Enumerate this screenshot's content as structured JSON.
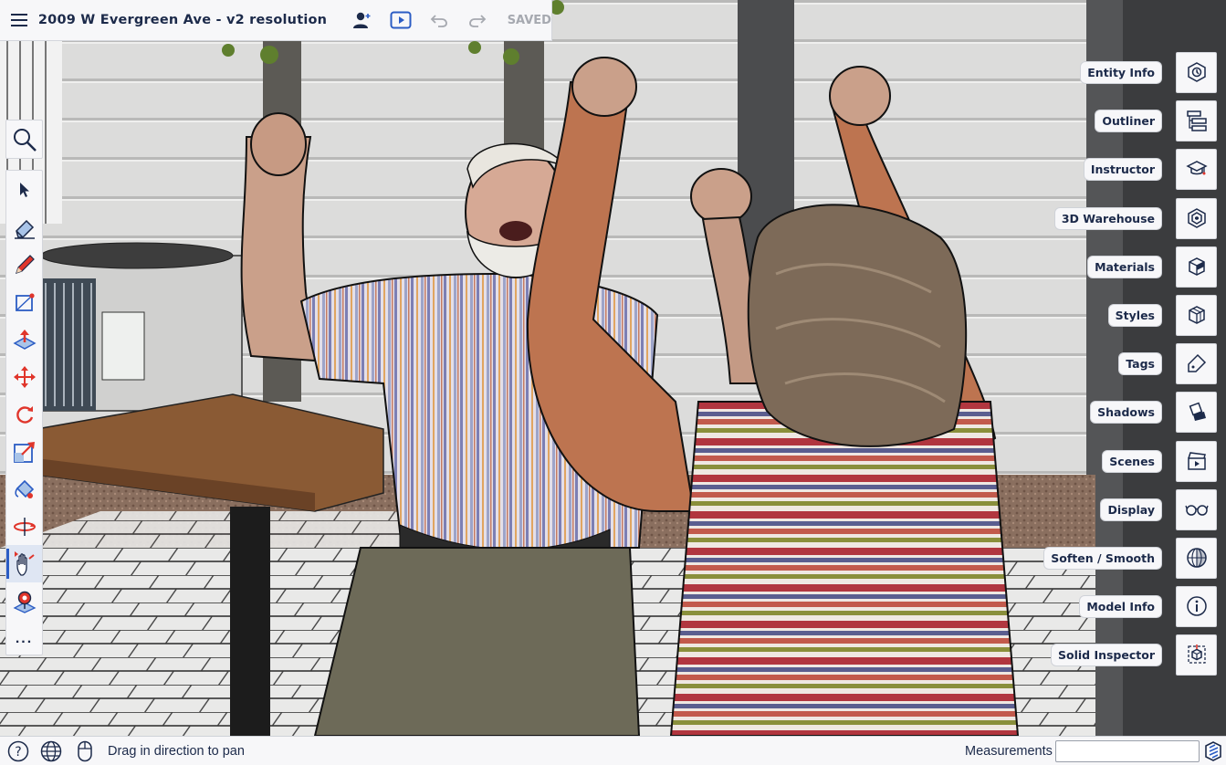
{
  "app": {
    "title": "2009 W Evergreen Ave - v2 resolution",
    "save_status": "SAVED",
    "accent": "#2b5cc4",
    "text_color": "#1c2a4a"
  },
  "topbar": {
    "icons": [
      "menu-icon",
      "collaborator-icon",
      "presentation-play-icon",
      "undo-icon",
      "redo-icon"
    ]
  },
  "left_toolbar": {
    "search_icon": "search-icon",
    "tools": [
      {
        "name": "select-tool",
        "icon": "cursor-arrow-icon"
      },
      {
        "name": "eraser-tool",
        "icon": "eraser-icon"
      },
      {
        "name": "line-tool",
        "icon": "pencil-icon"
      },
      {
        "name": "rectangle-tool",
        "icon": "rectangle-icon"
      },
      {
        "name": "push-pull-tool",
        "icon": "push-pull-icon"
      },
      {
        "name": "move-tool",
        "icon": "move-arrows-icon"
      },
      {
        "name": "rotate-tool",
        "icon": "rotate-icon"
      },
      {
        "name": "scale-tool",
        "icon": "scale-icon"
      },
      {
        "name": "paint-bucket-tool",
        "icon": "paint-bucket-icon"
      },
      {
        "name": "orbit-tool",
        "icon": "orbit-icon"
      },
      {
        "name": "pan-tool",
        "icon": "hand-pan-icon",
        "active": true
      },
      {
        "name": "position-camera-tool",
        "icon": "position-camera-icon"
      },
      {
        "name": "more-tools",
        "icon": "ellipsis-icon"
      }
    ],
    "more_label": "..."
  },
  "right_panels": [
    {
      "label": "Entity Info",
      "icon": "entity-info-icon"
    },
    {
      "label": "Outliner",
      "icon": "outliner-icon"
    },
    {
      "label": "Instructor",
      "icon": "graduation-cap-icon"
    },
    {
      "label": "3D Warehouse",
      "icon": "warehouse-icon"
    },
    {
      "label": "Materials",
      "icon": "materials-cube-icon"
    },
    {
      "label": "Styles",
      "icon": "styles-cube-icon"
    },
    {
      "label": "Tags",
      "icon": "tag-icon"
    },
    {
      "label": "Shadows",
      "icon": "shadows-icon"
    },
    {
      "label": "Scenes",
      "icon": "clapperboard-icon"
    },
    {
      "label": "Display",
      "icon": "glasses-icon"
    },
    {
      "label": "Soften / Smooth",
      "icon": "sphere-smooth-icon"
    },
    {
      "label": "Model Info",
      "icon": "info-circle-icon"
    },
    {
      "label": "Solid Inspector",
      "icon": "solid-inspector-icon"
    }
  ],
  "statusbar": {
    "help_icon": "help-circle-icon",
    "globe_icon": "globe-icon",
    "mouse_icon": "mouse-icon",
    "hint": "Drag in direction to pan",
    "measurements_label": "Measurements",
    "measurements_value": "",
    "brand_icon": "sketchup-logo-icon"
  }
}
